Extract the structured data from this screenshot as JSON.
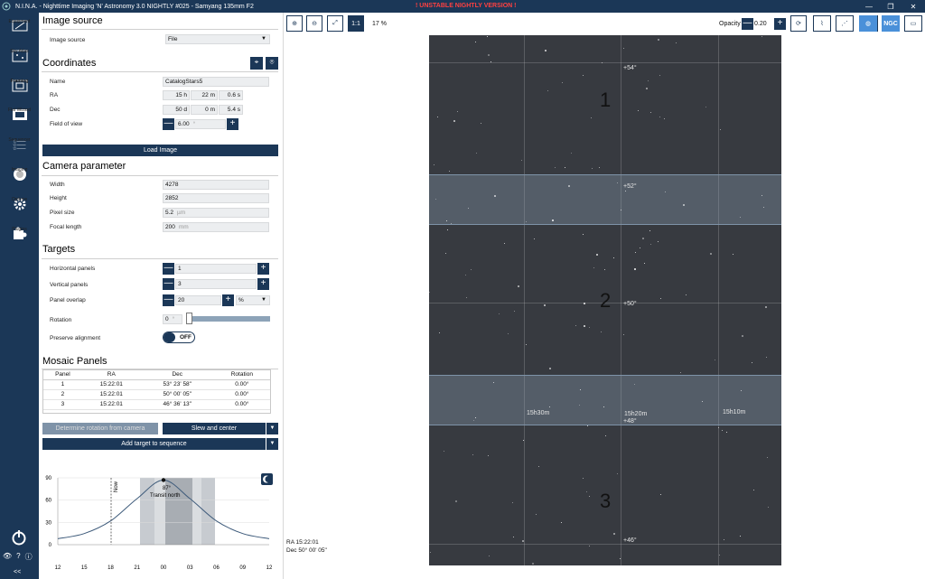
{
  "app": {
    "title": "N.I.N.A. - Nighttime Imaging 'N' Astronomy 3.0 NIGHTLY #025  -  Samyang 135mm F2",
    "warning": "! UNSTABLE NIGHTLY VERSION !"
  },
  "nav": {
    "items": [
      {
        "label": "Equipment"
      },
      {
        "label": "Sky Atlas"
      },
      {
        "label": "Framing"
      },
      {
        "label": "Flat Wizard"
      },
      {
        "label": "Sequencer"
      },
      {
        "label": "Imaging"
      },
      {
        "label": "Options"
      },
      {
        "label": "Plugins"
      }
    ],
    "collapse": "<<"
  },
  "image_source": {
    "title": "Image source",
    "label": "Image source",
    "value": "File"
  },
  "coordinates": {
    "title": "Coordinates",
    "name_label": "Name",
    "name_value": "CatalogStars5",
    "ra_label": "RA",
    "ra_h": "15 h",
    "ra_m": "22 m",
    "ra_s": "0.6 s",
    "dec_label": "Dec",
    "dec_d": "50 d",
    "dec_m": "0 m",
    "dec_s": "5.4 s",
    "fov_label": "Field of view",
    "fov_value": "6.00",
    "fov_unit": "°",
    "load_button": "Load Image"
  },
  "camera": {
    "title": "Camera parameter",
    "width_label": "Width",
    "width_value": "4278",
    "height_label": "Height",
    "height_value": "2852",
    "pixel_label": "Pixel size",
    "pixel_value": "5.2",
    "pixel_unit": "µm",
    "focal_label": "Focal length",
    "focal_value": "200",
    "focal_unit": "mm"
  },
  "targets": {
    "title": "Targets",
    "h_label": "Horizontal panels",
    "h_value": "1",
    "v_label": "Vertical panels",
    "v_value": "3",
    "overlap_label": "Panel overlap",
    "overlap_value": "20",
    "overlap_unit": "%",
    "rotation_label": "Rotation",
    "rotation_value": "0",
    "rotation_unit": "°",
    "preserve_label": "Preserve alignment",
    "preserve_state": "OFF"
  },
  "mosaic": {
    "title": "Mosaic Panels",
    "headers": [
      "Panel",
      "RA",
      "Dec",
      "Rotation"
    ],
    "rows": [
      [
        "1",
        "15:22:01",
        "53° 23' 58\"",
        "0.00°"
      ],
      [
        "2",
        "15:22:01",
        "50° 00' 05\"",
        "0.00°"
      ],
      [
        "3",
        "15:22:01",
        "46° 36' 13\"",
        "0.00°"
      ]
    ]
  },
  "actions": {
    "determine_rotation": "Determine rotation from camera",
    "slew_center": "Slew and center",
    "add_target": "Add target to sequence"
  },
  "altitude_chart": {
    "now_label": "Now",
    "transit_label": "Transit north",
    "transit_alt": "87°",
    "y_ticks": [
      "90",
      "60",
      "30",
      "0"
    ],
    "x_ticks": [
      "12",
      "15",
      "18",
      "21",
      "00",
      "03",
      "06",
      "09",
      "12"
    ]
  },
  "viewer": {
    "zoom_level": "17 %",
    "opacity_label": "Opacity",
    "opacity_value": "0.20",
    "ngc_label": "NGC",
    "scale_1to1": "1:1",
    "panels": [
      "1",
      "2",
      "3"
    ],
    "dec_labels": [
      "+54°",
      "+52°",
      "+50°",
      "+48°",
      "+46°"
    ],
    "ra_labels": [
      "15h30m",
      "15h20m",
      "15h10m"
    ],
    "info_ra": "RA  15:22:01",
    "info_dec": "Dec  50° 00' 05\""
  },
  "chart_data": {
    "type": "line",
    "x": [
      12,
      15,
      18,
      21,
      0,
      3,
      6,
      9,
      12
    ],
    "series": [
      {
        "values": [
          8,
          15,
          32,
          62,
          87,
          62,
          32,
          15,
          8
        ]
      }
    ],
    "ylim": [
      0,
      90
    ]
  }
}
